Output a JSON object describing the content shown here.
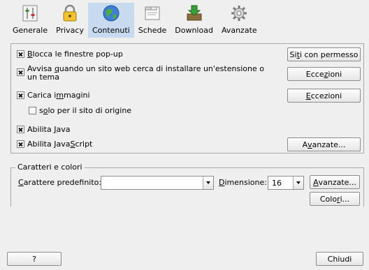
{
  "toolbar": {
    "items": [
      {
        "label": "Generale",
        "icon": "general-settings-icon",
        "selected": false
      },
      {
        "label": "Privacy",
        "icon": "lock-icon",
        "selected": false
      },
      {
        "label": "Contenuti",
        "icon": "globe-icon",
        "selected": true
      },
      {
        "label": "Schede",
        "icon": "tabs-icon",
        "selected": false
      },
      {
        "label": "Download",
        "icon": "download-icon",
        "selected": false
      },
      {
        "label": "Avanzate",
        "icon": "gear-icon",
        "selected": false
      }
    ]
  },
  "content": {
    "block_popups": {
      "pre": "",
      "key": "B",
      "post": "locca le finestre pop-up",
      "checked": true
    },
    "warn_install": {
      "pre": "Avvisa ",
      "key": "q",
      "post": "uando un sito web cerca di installare un'estensione o un tema",
      "checked": true
    },
    "load_images": {
      "pre": "Carica i",
      "key": "m",
      "post": "magini",
      "checked": true
    },
    "origin_only": {
      "pre": "s",
      "key": "o",
      "post": "lo per il sito di origine",
      "checked": false
    },
    "enable_java": {
      "pre": "Abilita ",
      "key": "J",
      "post": "ava",
      "checked": true
    },
    "enable_js": {
      "pre": "Abilita Java",
      "key": "S",
      "post": "cript",
      "checked": true
    },
    "allowed_sites_button": {
      "pre": "Si",
      "key": "t",
      "post": "i con permesso"
    },
    "exceptions_install_button": {
      "pre": "Ecce",
      "key": "z",
      "post": "ioni"
    },
    "exceptions_images_button": {
      "pre": "",
      "key": "E",
      "post": "ccezioni"
    },
    "js_advanced_button": {
      "pre": "A",
      "key": "v",
      "post": "anzate..."
    }
  },
  "fonts": {
    "group_title": "Caratteri e colori",
    "default_font_label": {
      "pre": "",
      "key": "C",
      "post": "arattere predefinito:"
    },
    "default_font_value": "",
    "size_label": {
      "pre": "",
      "key": "D",
      "post": "imensione:"
    },
    "size_value": "16",
    "advanced_button": {
      "pre": "",
      "key": "A",
      "post": "vanzate..."
    },
    "colors_button": {
      "pre": "Colo",
      "key": "r",
      "post": "i..."
    }
  },
  "footer": {
    "help_label": "?",
    "close_label": "Chiudi"
  },
  "colors": {
    "selected_tab_bg": "#c8daf0",
    "window_bg": "#efefef",
    "border": "#a9a9a9"
  }
}
